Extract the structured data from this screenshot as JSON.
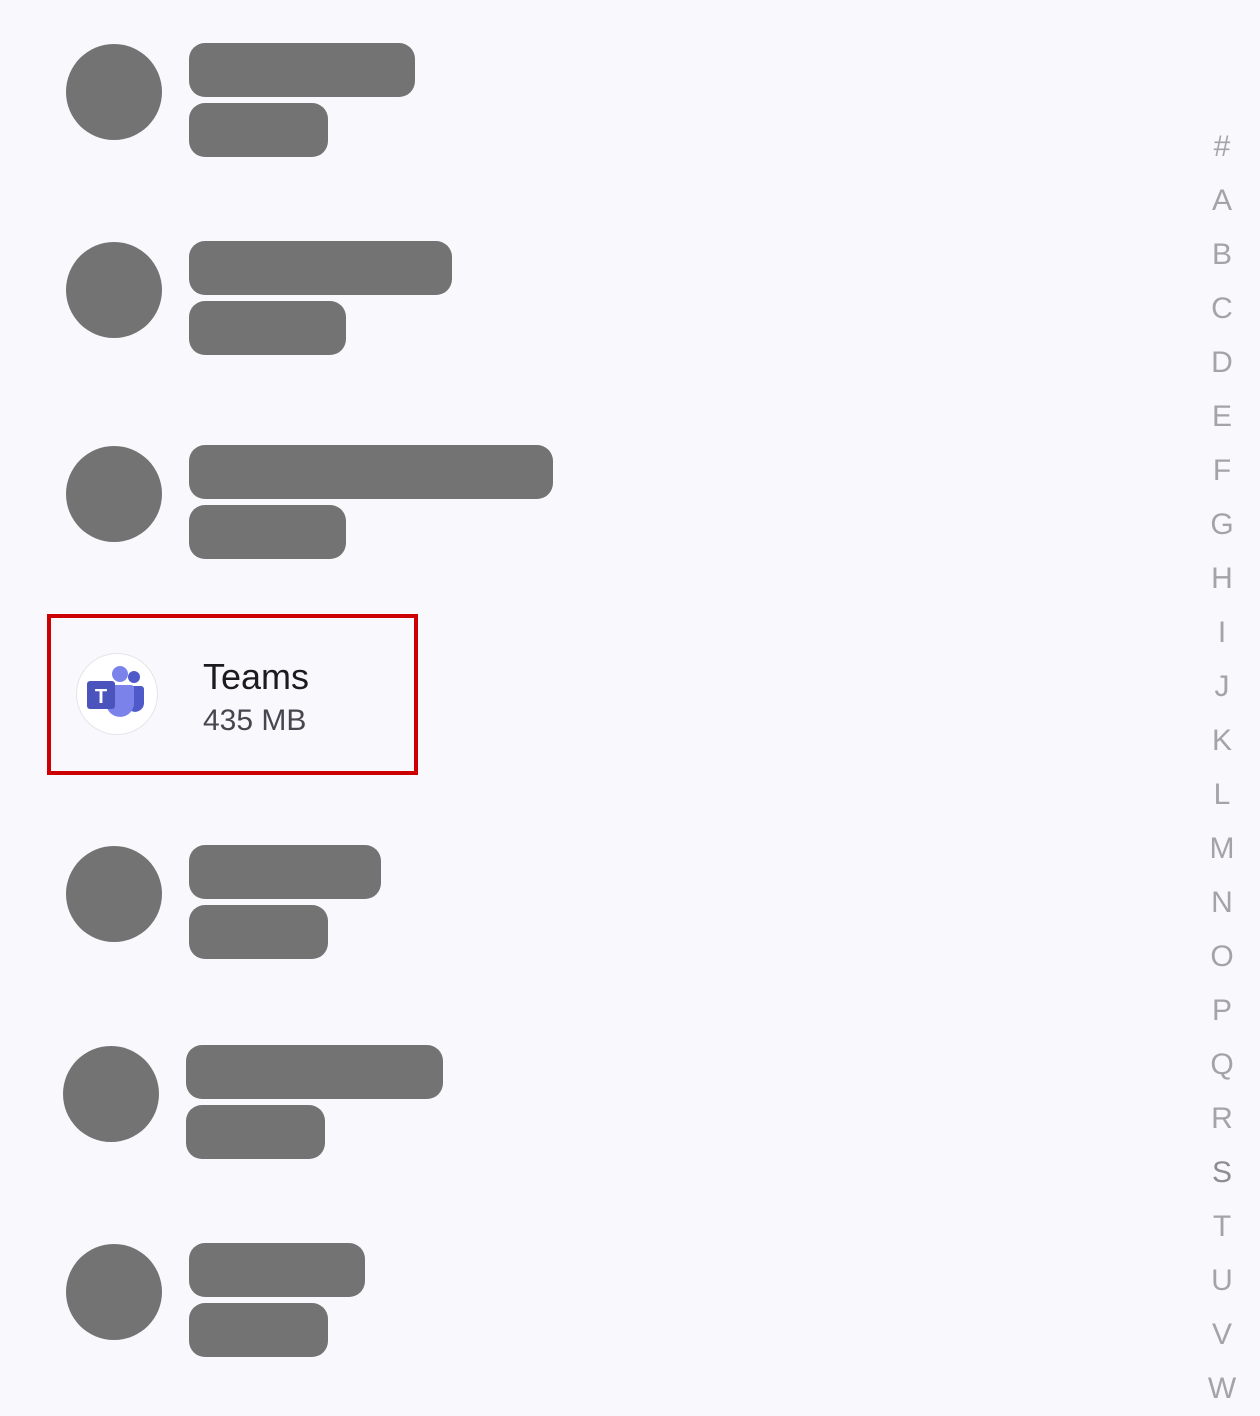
{
  "app_list": {
    "highlighted_app": {
      "name": "Teams",
      "size": "435 MB",
      "icon": "microsoft-teams-icon"
    }
  },
  "alpha_index": {
    "letters": [
      "#",
      "A",
      "B",
      "C",
      "D",
      "E",
      "F",
      "G",
      "H",
      "I",
      "J",
      "K",
      "L",
      "M",
      "N",
      "O",
      "P",
      "Q",
      "R",
      "S",
      "T",
      "U",
      "V",
      "W"
    ],
    "active": "S"
  },
  "colors": {
    "background": "#f8f8fd",
    "placeholder": "#737373",
    "highlight_border": "#cc0000",
    "index_text": "#a3a3a8",
    "teams_purple": "#5059c9",
    "teams_light": "#7b83eb"
  }
}
